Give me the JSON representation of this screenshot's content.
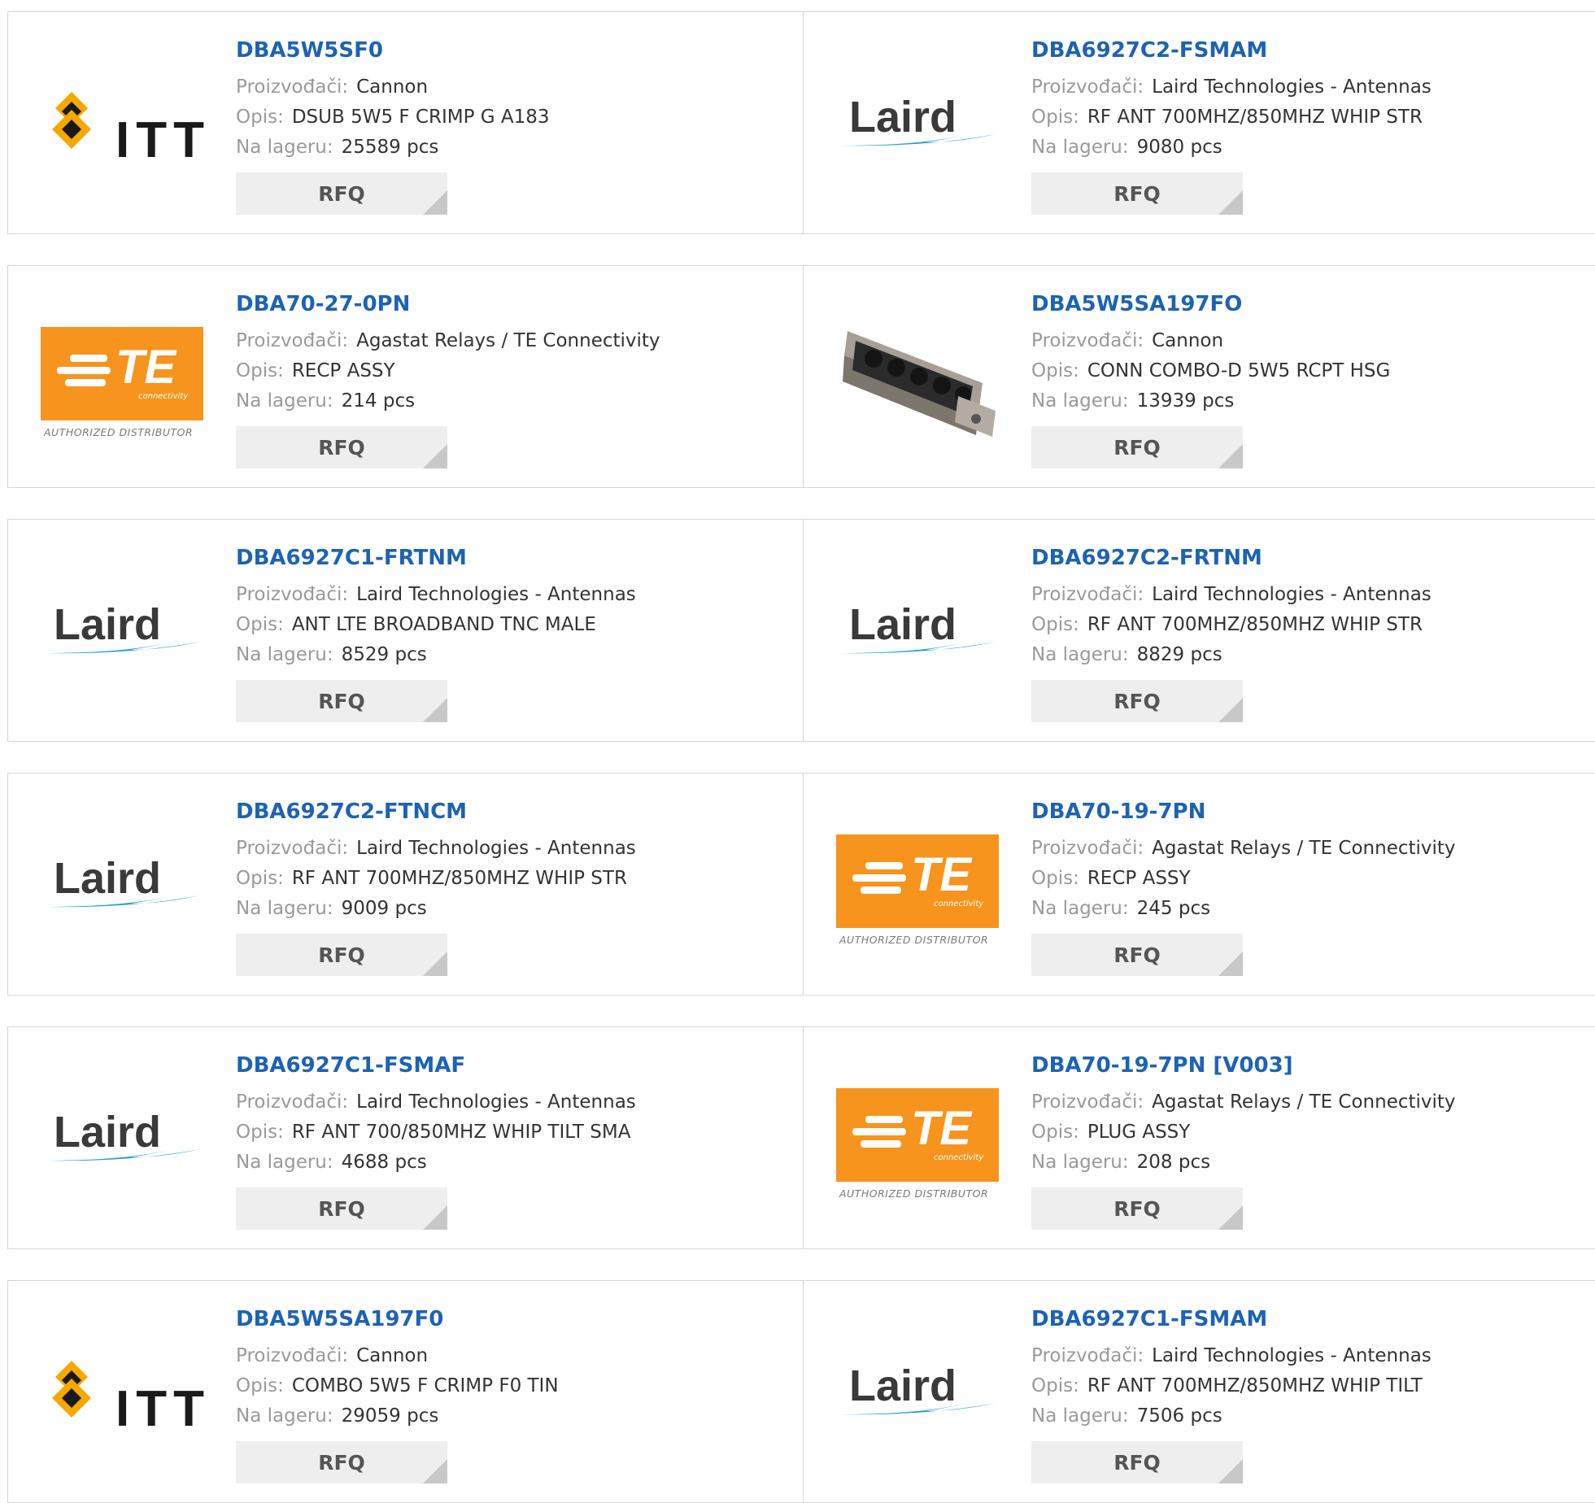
{
  "labels": {
    "manufacturer": "Proizvođači:",
    "description": "Opis:",
    "stock": "Na lageru:",
    "rfq": "RFQ"
  },
  "colors": {
    "part_link": "#1d63b4",
    "te_orange": "#f7941d",
    "laird_swoosh": "#1e9fd8",
    "itt_gold": "#f5a800"
  },
  "products": [
    {
      "part": "DBA5W5SF0",
      "logo": "itt-logo",
      "manufacturer": "Cannon",
      "description": "DSUB 5W5 F CRIMP G A183",
      "stock": "25589 pcs"
    },
    {
      "part": "DBA6927C2-FSMAM",
      "logo": "laird-logo",
      "manufacturer": "Laird Technologies - Antennas",
      "description": "RF ANT 700MHZ/850MHZ WHIP STR",
      "stock": "9080 pcs"
    },
    {
      "part": "DBA70-27-0PN",
      "logo": "te-logo",
      "manufacturer": "Agastat Relays / TE Connectivity",
      "description": "RECP ASSY",
      "stock": "214 pcs"
    },
    {
      "part": "DBA5W5SA197FO",
      "logo": "connector-photo",
      "manufacturer": "Cannon",
      "description": "CONN COMBO-D 5W5 RCPT HSG",
      "stock": "13939 pcs"
    },
    {
      "part": "DBA6927C1-FRTNM",
      "logo": "laird-logo",
      "manufacturer": "Laird Technologies - Antennas",
      "description": "ANT LTE BROADBAND TNC MALE",
      "stock": "8529 pcs"
    },
    {
      "part": "DBA6927C2-FRTNM",
      "logo": "laird-logo",
      "manufacturer": "Laird Technologies - Antennas",
      "description": "RF ANT 700MHZ/850MHZ WHIP STR",
      "stock": "8829 pcs"
    },
    {
      "part": "DBA6927C2-FTNCM",
      "logo": "laird-logo",
      "manufacturer": "Laird Technologies - Antennas",
      "description": "RF ANT 700MHZ/850MHZ WHIP STR",
      "stock": "9009 pcs"
    },
    {
      "part": "DBA70-19-7PN",
      "logo": "te-logo",
      "manufacturer": "Agastat Relays / TE Connectivity",
      "description": "RECP ASSY",
      "stock": "245 pcs"
    },
    {
      "part": "DBA6927C1-FSMAF",
      "logo": "laird-logo",
      "manufacturer": "Laird Technologies - Antennas",
      "description": "RF ANT 700/850MHZ WHIP TILT SMA",
      "stock": "4688 pcs"
    },
    {
      "part": "DBA70-19-7PN [V003]",
      "logo": "te-logo",
      "manufacturer": "Agastat Relays / TE Connectivity",
      "description": "PLUG ASSY",
      "stock": "208 pcs"
    },
    {
      "part": "DBA5W5SA197F0",
      "logo": "itt-logo",
      "manufacturer": "Cannon",
      "description": "COMBO 5W5 F CRIMP F0 TIN",
      "stock": "29059 pcs"
    },
    {
      "part": "DBA6927C1-FSMAM",
      "logo": "laird-logo",
      "manufacturer": "Laird Technologies - Antennas",
      "description": "RF ANT 700MHZ/850MHZ WHIP TILT",
      "stock": "7506 pcs"
    }
  ],
  "logo_text": {
    "itt": "ITT",
    "laird": "Laird",
    "te": "TE",
    "te_sub": "connectivity",
    "te_authorized": "AUTHORIZED DISTRIBUTOR"
  }
}
